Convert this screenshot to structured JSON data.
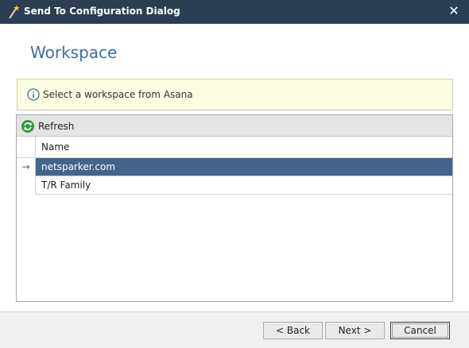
{
  "window": {
    "title": "Send To Configuration Dialog",
    "close_glyph": "✕"
  },
  "page": {
    "heading": "Workspace"
  },
  "info": {
    "message": "Select a workspace from Asana",
    "icon": "info-icon"
  },
  "grid": {
    "toolbar": {
      "refresh_label": "Refresh",
      "refresh_icon": "refresh-icon"
    },
    "columns": [
      "Name"
    ],
    "rows": [
      {
        "name": "netsparker.com",
        "selected": true,
        "indicator": "→"
      },
      {
        "name": "T/R Family",
        "selected": false,
        "indicator": ""
      }
    ]
  },
  "footer": {
    "back_label": "< Back",
    "next_label": "Next >",
    "cancel_label": "Cancel"
  },
  "colors": {
    "titlebar": "#2b3e53",
    "heading": "#3d6fa6",
    "info_bg": "#fdfde1",
    "selected_row": "#43658b"
  }
}
